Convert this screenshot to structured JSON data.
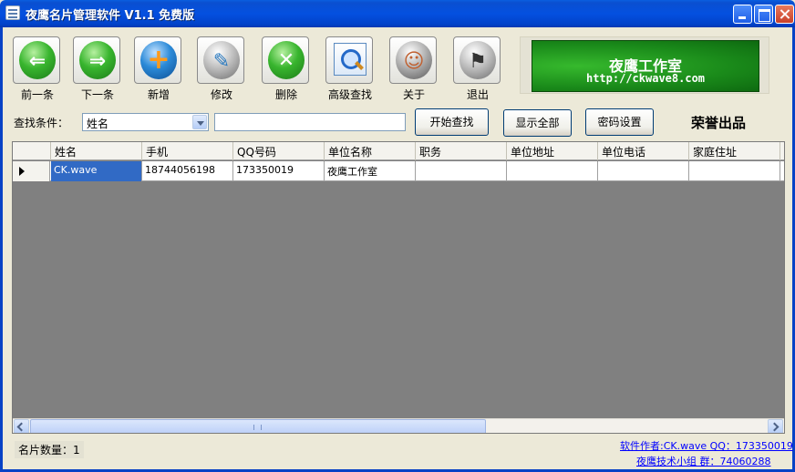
{
  "window": {
    "title": "夜鹰名片管理软件 V1.1 免费版"
  },
  "toolbar": {
    "items": [
      {
        "label": "前一条",
        "icon": "arrow-left-icon",
        "glyph": "⇐"
      },
      {
        "label": "下一条",
        "icon": "arrow-right-icon",
        "glyph": "⇒"
      },
      {
        "label": "新增",
        "icon": "plus-icon",
        "glyph": "+"
      },
      {
        "label": "修改",
        "icon": "quill-icon",
        "glyph": "✎"
      },
      {
        "label": "删除",
        "icon": "delete-icon",
        "glyph": "✕"
      },
      {
        "label": "高级查找",
        "icon": "magnifier-icon",
        "glyph": ""
      },
      {
        "label": "关于",
        "icon": "info-icon",
        "glyph": "☺"
      },
      {
        "label": "退出",
        "icon": "exit-icon",
        "glyph": "⚑"
      }
    ]
  },
  "banner": {
    "title": "夜鹰工作室",
    "url": "http://ckwave8.com"
  },
  "search": {
    "label": "查找条件：",
    "field_value": "姓名",
    "input_value": "",
    "search_button": "开始查找",
    "show_all_button": "显示全部",
    "password_button": "密码设置",
    "honor": "荣誉出品"
  },
  "grid": {
    "columns": [
      "姓名",
      "手机",
      "QQ号码",
      "单位名称",
      "职务",
      "单位地址",
      "单位电话",
      "家庭住址"
    ],
    "rows": [
      [
        "CK.wave",
        "18744056198",
        "173350019",
        "夜鹰工作室",
        "",
        "",
        "",
        ""
      ]
    ]
  },
  "status": {
    "count_label": "名片数量：",
    "count_value": "1",
    "author_link": "软件作者:CK.wave QQ：173350019",
    "group_link": "夜鹰技术小组  群：74060288"
  },
  "colors": {
    "titlebar": "#0450e0",
    "selection": "#316ac5",
    "banner_green": "#1a8a1a",
    "grid_background": "#808080"
  }
}
